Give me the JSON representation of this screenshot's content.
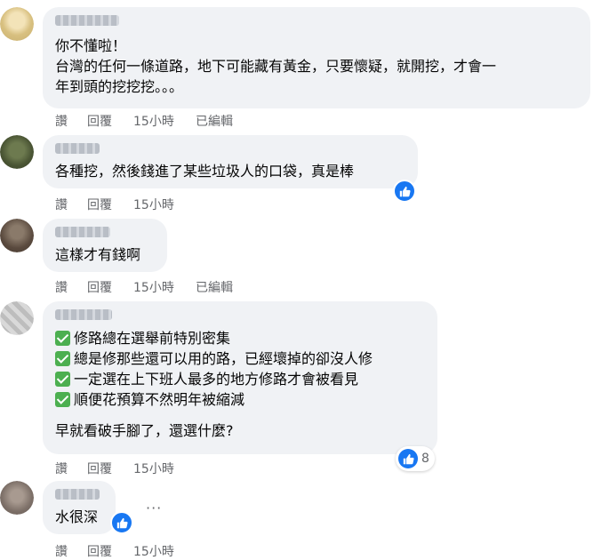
{
  "comments": [
    {
      "lines": [
        "你不懂啦！",
        "台灣的任何一條道路，地下可能藏有黃金，只要懷疑，就開挖，才會一",
        "年到頭的挖挖挖。。。"
      ],
      "actions": {
        "like": "讚",
        "reply": "回覆",
        "time": "15小時",
        "edited": "已編輯"
      }
    },
    {
      "lines": [
        "各種挖，然後錢進了某些垃圾人的口袋，真是棒"
      ],
      "actions": {
        "like": "讚",
        "reply": "回覆",
        "time": "15小時"
      }
    },
    {
      "lines": [
        "這樣才有錢啊"
      ],
      "actions": {
        "like": "讚",
        "reply": "回覆",
        "time": "15小時",
        "edited": "已編輯"
      }
    },
    {
      "checklist": [
        "修路總在選舉前特別密集",
        "總是修那些還可以用的路，已經壞掉的卻沒人修",
        "一定選在上下班人最多的地方修路才會被看見",
        "順便花預算不然明年被縮減"
      ],
      "closing": "早就看破手腳了，還選什麼?",
      "reaction_count": "8",
      "actions": {
        "like": "讚",
        "reply": "回覆",
        "time": "15小時"
      }
    },
    {
      "lines": [
        "水很深"
      ],
      "more": "···",
      "actions": {
        "like": "讚",
        "reply": "回覆",
        "time": "15小時"
      }
    }
  ],
  "colors": {
    "bubble": "#f0f2f5",
    "like_blue": "#1877f2",
    "meta_gray": "#65676b",
    "check_green": "#4caf50"
  }
}
